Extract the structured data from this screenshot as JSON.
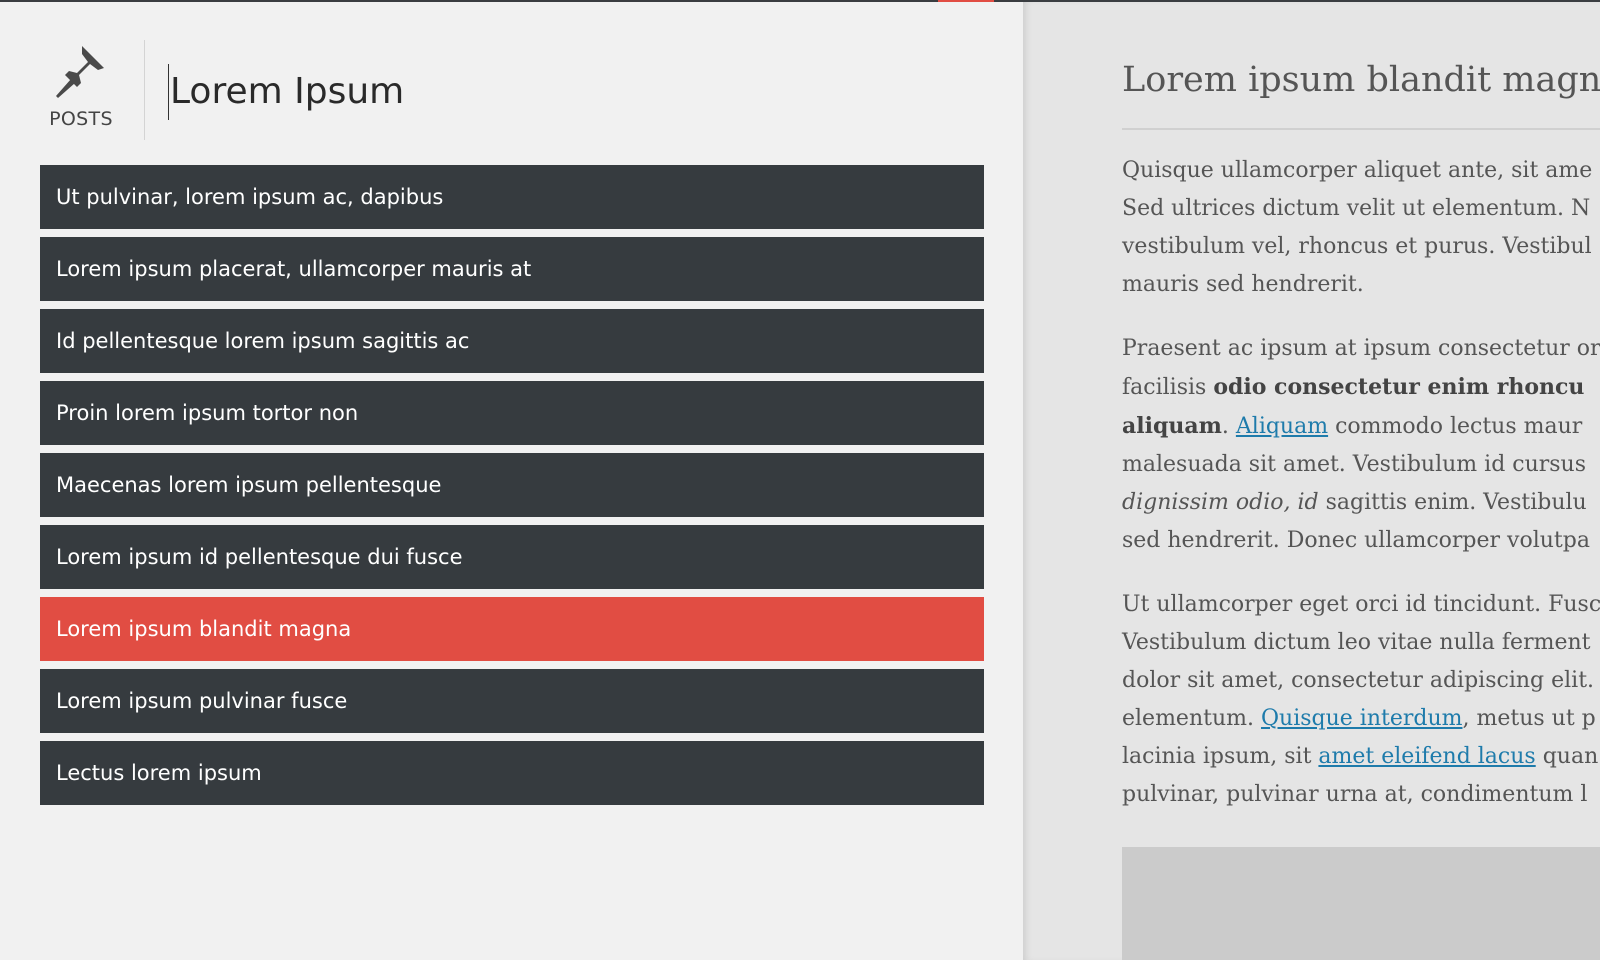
{
  "header": {
    "posts_label": "POSTS",
    "title_value": "Lorem Ipsum",
    "posts_icon": "pushpin-icon"
  },
  "posts": [
    {
      "label": "Ut pulvinar, lorem ipsum ac, dapibus"
    },
    {
      "label": "Lorem ipsum placerat, ullamcorper mauris at"
    },
    {
      "label": "Id pellentesque lorem ipsum sagittis ac"
    },
    {
      "label": "Proin lorem ipsum tortor non"
    },
    {
      "label": "Maecenas lorem ipsum pellentesque"
    },
    {
      "label": "Lorem ipsum id pellentesque dui fusce"
    },
    {
      "label": "Lorem ipsum blandit magna"
    },
    {
      "label": "Lorem ipsum pulvinar fusce"
    },
    {
      "label": "Lectus lorem ipsum"
    }
  ],
  "active_post_index": 6,
  "preview": {
    "title": "Lorem ipsum blandit magna",
    "p1": [
      "Quisque ullamcorper aliquet ante, sit ame",
      "Sed ultrices dictum velit ut elementum. N",
      "vestibulum vel, rhoncus et purus. Vestibul",
      "mauris sed hendrerit."
    ],
    "p2": {
      "l1": "Praesent ac ipsum at ipsum consectetur or",
      "l2_a": "facilisis ",
      "l2_bold": "odio consectetur enim rhoncu",
      "l3_bold": "aliquam",
      "l3_sep": ". ",
      "l3_link": "Aliquam",
      "l3_b": " commodo lectus maur",
      "l4": "malesuada sit amet. Vestibulum id cursus",
      "l5_italic": "dignissim odio, id",
      "l5_b": " sagittis enim. Vestibulu",
      "l6": "sed hendrerit. Donec ullamcorper volutpa"
    },
    "p3": {
      "l1": "Ut ullamcorper eget orci id tincidunt. Fusc",
      "l2": "Vestibulum dictum leo vitae nulla ferment",
      "l3": "dolor sit amet, consectetur adipiscing elit.",
      "l4_a": "elementum. ",
      "l4_link": "Quisque interdum",
      "l4_b": ", metus ut p",
      "l5_a": "lacinia ipsum, sit ",
      "l5_link": "amet eleifend lacus",
      "l5_b": " quan",
      "l6": "pulvinar, pulvinar urna at, condimentum l"
    }
  },
  "colors": {
    "accent": "#e14d43",
    "item_bg": "#363b3f",
    "link": "#1e7bab"
  }
}
